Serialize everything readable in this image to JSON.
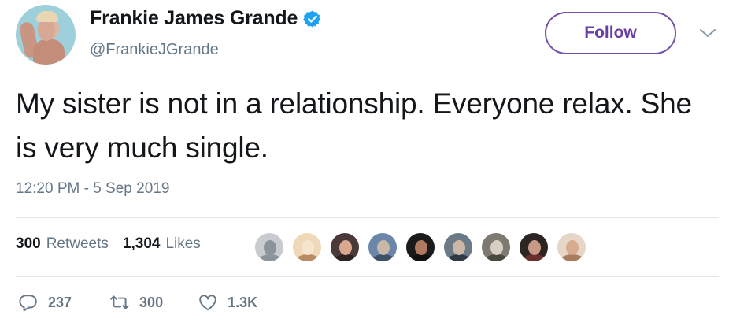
{
  "user": {
    "display_name": "Frankie James Grande",
    "handle": "@FrankieJGrande",
    "verified": true
  },
  "follow_label": "Follow",
  "tweet": {
    "text": "My sister is not in a relationship. Everyone relax. She is very much single.",
    "timestamp": "12:20 PM - 5 Sep 2019"
  },
  "stats": {
    "retweets_count": "300",
    "retweets_label": "Retweets",
    "likes_count": "1,304",
    "likes_label": "Likes"
  },
  "likers": [
    {
      "bg": "#c8ccd0",
      "skin": "#8c949b",
      "shoulders": "#8c949b"
    },
    {
      "bg": "#f0d9b8",
      "skin": "#f7e4cf",
      "shoulders": "#b98a63"
    },
    {
      "bg": "#4a3b3a",
      "skin": "#d9a88f",
      "shoulders": "#2e2221"
    },
    {
      "bg": "#6b86a8",
      "skin": "#c7b8a8",
      "shoulders": "#3f4f66"
    },
    {
      "bg": "#1b1b1b",
      "skin": "#b07a5e",
      "shoulders": "#111111"
    },
    {
      "bg": "#6c7a88",
      "skin": "#cdb7a7",
      "shoulders": "#2f3a44"
    },
    {
      "bg": "#7d7a72",
      "skin": "#d8cfc2",
      "shoulders": "#4b4841"
    },
    {
      "bg": "#2d2524",
      "skin": "#c99a83",
      "shoulders": "#6a2f2a"
    },
    {
      "bg": "#e6d6c8",
      "skin": "#d9ab8e",
      "shoulders": "#a77b5c"
    }
  ],
  "actions": {
    "replies": "237",
    "retweets": "300",
    "likes": "1.3K"
  },
  "colors": {
    "follow_border": "#7150a6",
    "verified": "#1da1f2",
    "secondary_text": "#657786",
    "divider": "#e1e8ed"
  },
  "icons": {
    "verified": "verified-badge-icon",
    "caret": "chevron-down-icon",
    "reply": "reply-icon",
    "retweet": "retweet-icon",
    "like": "heart-icon"
  }
}
